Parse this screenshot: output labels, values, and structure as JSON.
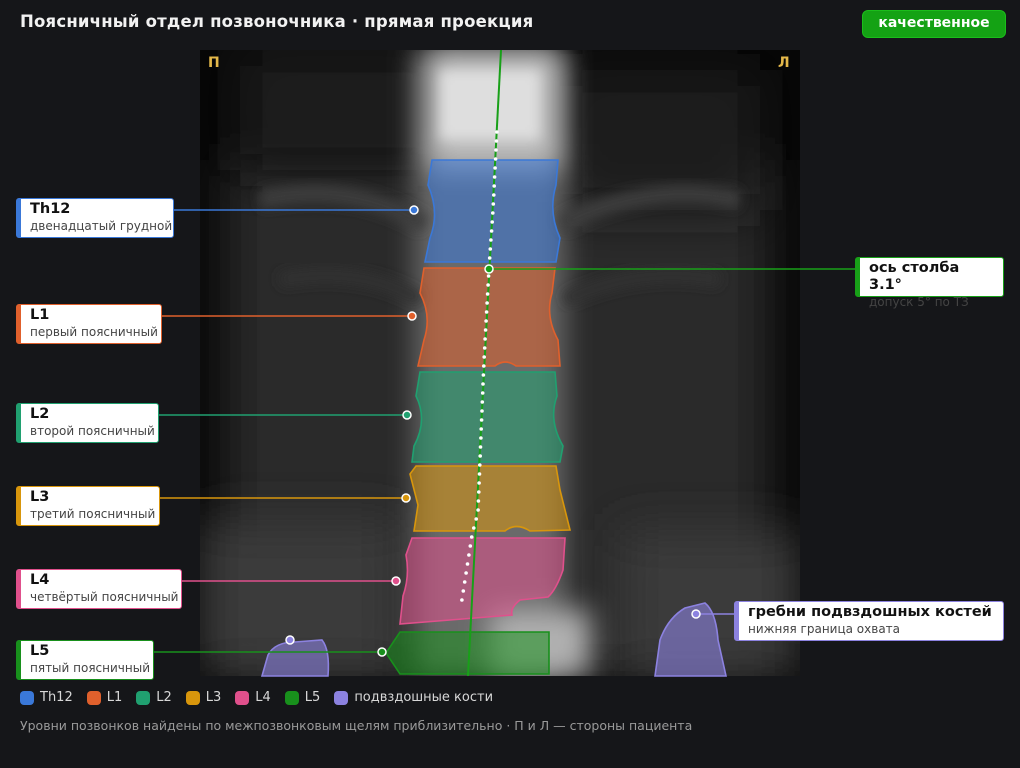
{
  "header": {
    "title": "Поясничный отдел позвоночника · прямая проекция",
    "status": "качественное"
  },
  "image": {
    "side_right_patient": "П",
    "side_left_patient": "Л"
  },
  "vertebrae": [
    {
      "id": "Th12",
      "name": "Th12",
      "desc": "двенадцатый грудной",
      "color": "#3a78d8"
    },
    {
      "id": "L1",
      "name": "L1",
      "desc": "первый поясничный",
      "color": "#e0602c"
    },
    {
      "id": "L2",
      "name": "L2",
      "desc": "второй поясничный",
      "color": "#20a070"
    },
    {
      "id": "L3",
      "name": "L3",
      "desc": "третий поясничный",
      "color": "#d8960c"
    },
    {
      "id": "L4",
      "name": "L4",
      "desc": "четвёртый поясничный",
      "color": "#e0508c"
    },
    {
      "id": "L5",
      "name": "L5",
      "desc": "пятый поясничный",
      "color": "#18901c"
    }
  ],
  "axis": {
    "name": "ось столба 3.1°",
    "desc": "допуск 5° по ТЗ",
    "angle_deg": 3.1,
    "color": "#18a018"
  },
  "iliac": {
    "name": "гребни подвздошных костей",
    "desc": "нижняя граница охвата",
    "color": "#8c82e0"
  },
  "legend": [
    {
      "label": "Th12",
      "color": "#3a78d8"
    },
    {
      "label": "L1",
      "color": "#e0602c"
    },
    {
      "label": "L2",
      "color": "#20a070"
    },
    {
      "label": "L3",
      "color": "#d8960c"
    },
    {
      "label": "L4",
      "color": "#e0508c"
    },
    {
      "label": "L5",
      "color": "#18901c"
    },
    {
      "label": "подвздошные кости",
      "color": "#8c82e0"
    }
  ],
  "footnote": "Уровни позвонков найдены по межпозвонковым щелям приблизительно · П и Л — стороны пациента"
}
